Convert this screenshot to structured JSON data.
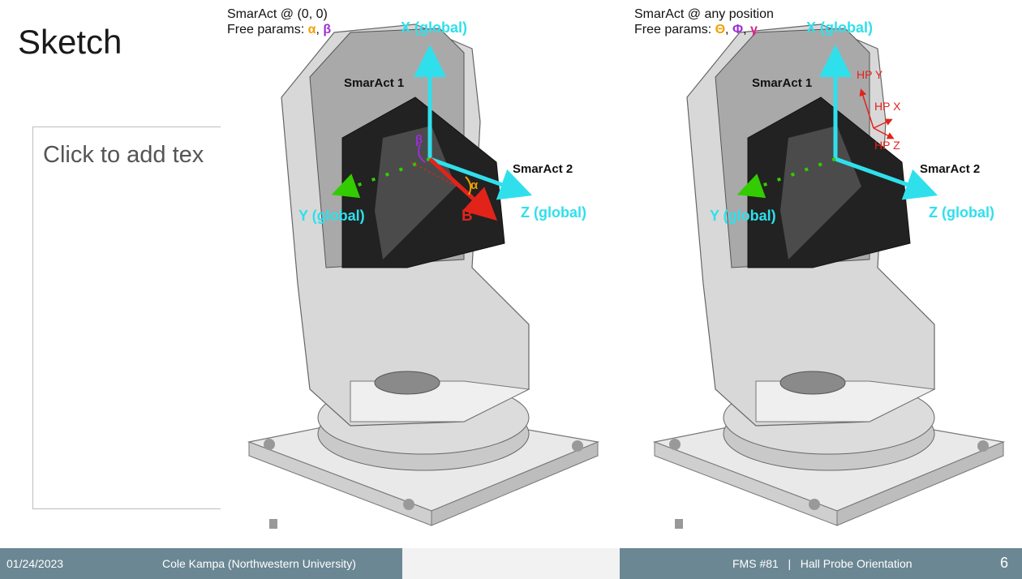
{
  "slide": {
    "title": "Sketch",
    "placeholder": "Click to add tex"
  },
  "left_figure": {
    "caption_line1": "SmarAct @ (0, 0)",
    "caption_prefix": "Free params: ",
    "param1": "α",
    "separator": ", ",
    "param2": "β",
    "label_x": "X (global)",
    "label_y": "Y (global)",
    "label_z": "Z (global)",
    "label_smaract1": "SmarAct 1",
    "label_smaract2": "SmarAct 2",
    "label_beta": "β",
    "label_alpha": "α",
    "label_b": "B"
  },
  "right_figure": {
    "caption_line1": "SmarAct @ any position",
    "caption_prefix": "Free params: ",
    "param1": "Θ",
    "separator1": ", ",
    "param2": "Φ",
    "separator2": ", ",
    "param3": "γ",
    "label_x": "X (global)",
    "label_y": "Y (global)",
    "label_z": "Z (global)",
    "label_smaract1": "SmarAct 1",
    "label_smaract2": "SmarAct 2",
    "label_hpy": "HP Y",
    "label_hpx": "HP X",
    "label_hpz": "HP Z"
  },
  "footer": {
    "date": "01/24/2023",
    "author": "Cole Kampa (Northwestern University)",
    "meeting": "FMS #81   |   Hall Probe Orientation",
    "page": "6"
  },
  "colors": {
    "axis_cyan": "#2fe0ec",
    "axis_green": "#33cc00",
    "vector_red": "#e2231a",
    "alpha_orange": "#f0a000",
    "beta_purple": "#9a2fd6",
    "gamma_magenta": "#e0208a",
    "footer_bg": "#6b8793"
  }
}
